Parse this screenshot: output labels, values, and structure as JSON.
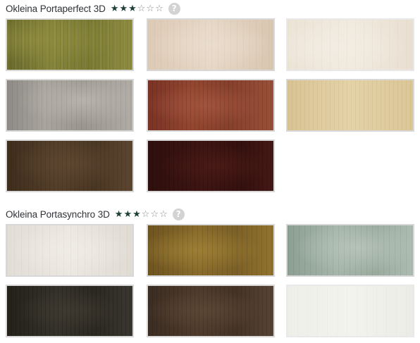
{
  "sections": [
    {
      "title": "Okleina Portaperfect 3D",
      "rating": 3,
      "rating_max": 6,
      "help_icon": "?",
      "swatches": [
        {
          "name": "olive-oak",
          "color": "#7c7a35"
        },
        {
          "name": "light-beige-wood",
          "color": "#dfcfbd"
        },
        {
          "name": "cream-white-wood",
          "color": "#ede5d9"
        },
        {
          "name": "grey-oak",
          "color": "#a09c96"
        },
        {
          "name": "red-brown-wood",
          "color": "#8c4330"
        },
        {
          "name": "light-ash",
          "color": "#dfcc9e"
        },
        {
          "name": "dark-walnut",
          "color": "#4d3a26"
        },
        {
          "name": "mahogany",
          "color": "#3b1311"
        }
      ]
    },
    {
      "title": "Okleina Portasynchro 3D",
      "rating": 3,
      "rating_max": 6,
      "help_icon": "?",
      "swatches": [
        {
          "name": "white-pine",
          "color": "#e6e2db"
        },
        {
          "name": "golden-oak",
          "color": "#80632a"
        },
        {
          "name": "sage-grey-oak",
          "color": "#9fb0a4"
        },
        {
          "name": "dark-oak",
          "color": "#2f2c24"
        },
        {
          "name": "brown-oak",
          "color": "#4a382a"
        },
        {
          "name": "white-smooth",
          "color": "#efefe9"
        }
      ]
    }
  ]
}
